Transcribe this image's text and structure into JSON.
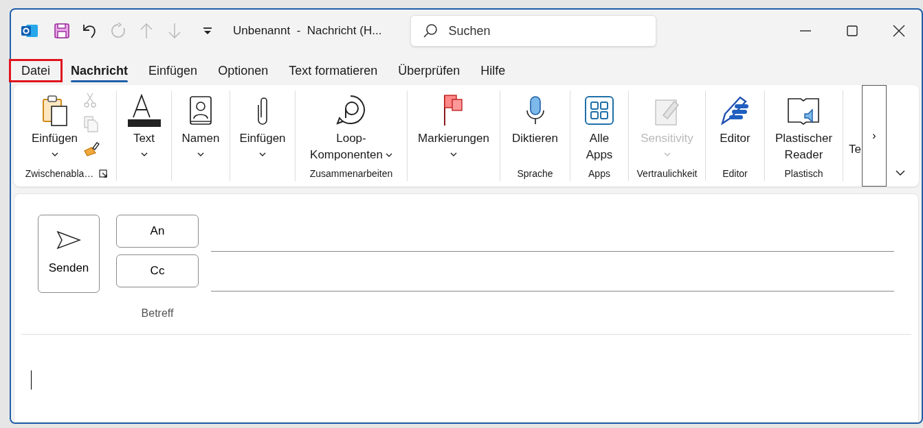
{
  "window": {
    "title": "Unbenannt  -  Nachricht (H...",
    "search": {
      "placeholder": "Suchen"
    }
  },
  "quick_access": [
    {
      "kind": "save",
      "disabled": false
    },
    {
      "kind": "undo",
      "disabled": false
    },
    {
      "kind": "redo",
      "disabled": true
    },
    {
      "kind": "up",
      "disabled": true
    },
    {
      "kind": "down",
      "disabled": true
    },
    {
      "kind": "customize",
      "disabled": false
    }
  ],
  "tabs": [
    {
      "label": "Datei",
      "selected": false,
      "highlighted": true
    },
    {
      "label": "Nachricht",
      "selected": true,
      "highlighted": false
    },
    {
      "label": "Einfügen",
      "selected": false,
      "highlighted": false
    },
    {
      "label": "Optionen",
      "selected": false,
      "highlighted": false
    },
    {
      "label": "Text formatieren",
      "selected": false,
      "highlighted": false
    },
    {
      "label": "Überprüfen",
      "selected": false,
      "highlighted": false
    },
    {
      "label": "Hilfe",
      "selected": false,
      "highlighted": false
    }
  ],
  "ribbon": {
    "groups": [
      {
        "label": "Zwischenabla…",
        "launcher": true,
        "buttons": [
          {
            "kind": "paste",
            "label": "Einfügen",
            "dropdown": true,
            "disabled": false
          },
          {
            "kind": "cut",
            "disabled": true
          },
          {
            "kind": "copy",
            "disabled": true
          },
          {
            "kind": "painter",
            "disabled": false
          }
        ]
      },
      {
        "buttons": [
          {
            "kind": "font",
            "label": "Text",
            "dropdown": true,
            "disabled": false
          }
        ]
      },
      {
        "buttons": [
          {
            "kind": "names",
            "label": "Namen",
            "dropdown": true,
            "disabled": false
          }
        ]
      },
      {
        "buttons": [
          {
            "kind": "attach",
            "label": "Einfügen",
            "dropdown": true,
            "disabled": false
          }
        ]
      },
      {
        "label": "Zusammenarbeiten",
        "buttons": [
          {
            "kind": "loop",
            "label": "Loop-",
            "label_2": "Komponenten",
            "dropdown": true,
            "disabled": false
          }
        ]
      },
      {
        "buttons": [
          {
            "kind": "flag",
            "label": "Markierungen",
            "dropdown": true,
            "disabled": false
          }
        ]
      },
      {
        "label": "Sprache",
        "buttons": [
          {
            "kind": "mic",
            "label": "Diktieren",
            "dropdown": false,
            "disabled": false
          }
        ]
      },
      {
        "label": "Apps",
        "buttons": [
          {
            "kind": "apps",
            "label": "Alle",
            "label_2": "Apps",
            "dropdown": false,
            "disabled": false
          }
        ]
      },
      {
        "label": "Vertraulichkeit",
        "buttons": [
          {
            "kind": "sensitivity",
            "label": "Sensitivity",
            "dropdown": true,
            "disabled": true
          }
        ]
      },
      {
        "label": "Editor",
        "buttons": [
          {
            "kind": "editor",
            "label": "Editor",
            "dropdown": false,
            "disabled": false
          }
        ]
      },
      {
        "label": "Plastisch",
        "buttons": [
          {
            "kind": "reader",
            "label": "Plastischer",
            "label_2": "Reader",
            "dropdown": false,
            "disabled": false
          }
        ]
      },
      {
        "buttons": [
          {
            "kind": "partial",
            "label": "Te",
            "dropdown": false,
            "disabled": false
          }
        ]
      }
    ],
    "more": "›"
  },
  "compose": {
    "send": "Senden",
    "to": "An",
    "cc": "Cc",
    "subject_label": "Betreff"
  }
}
